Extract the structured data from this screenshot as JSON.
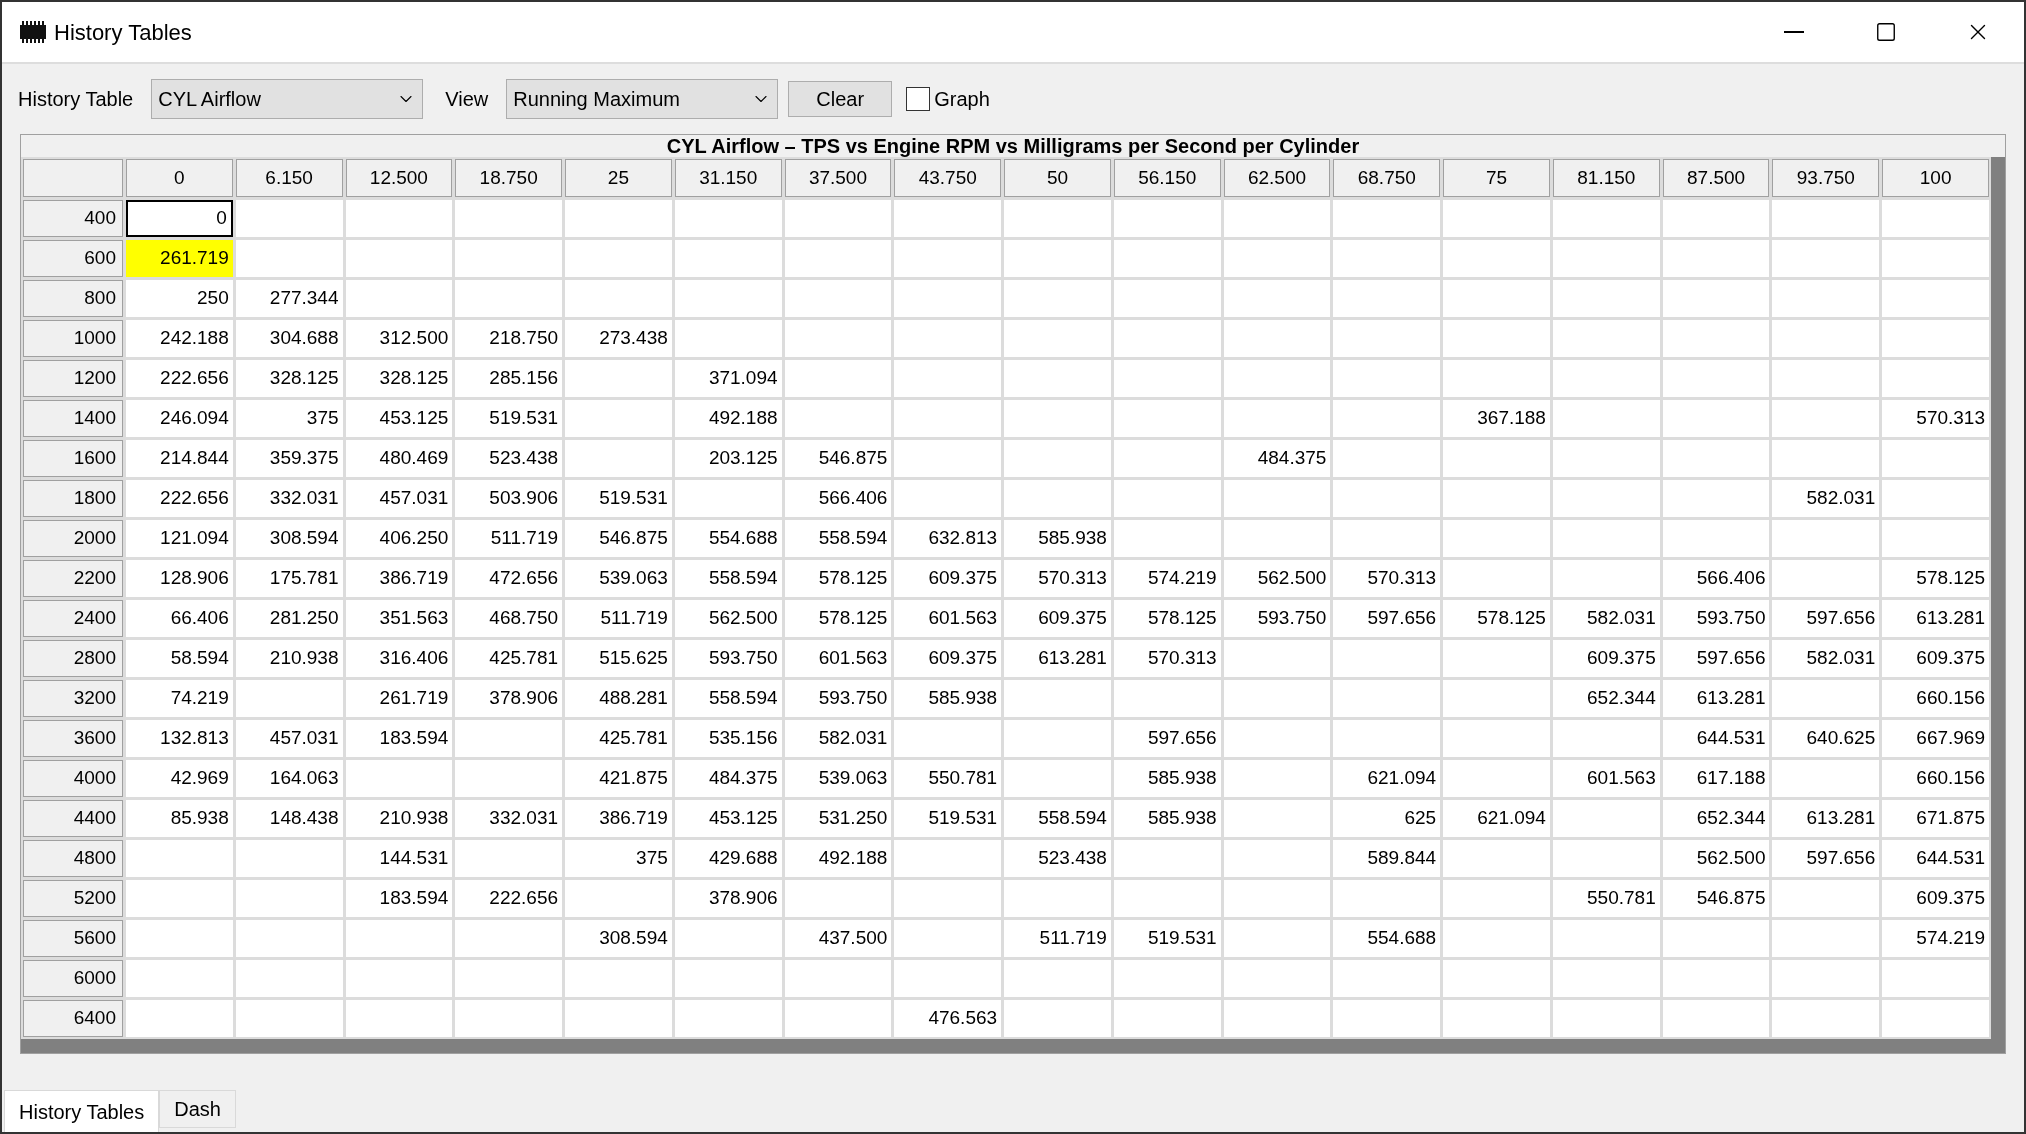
{
  "window": {
    "title": "History Tables"
  },
  "toolbar": {
    "history_table_label": "History Table",
    "history_table_value": "CYL Airflow",
    "view_label": "View",
    "view_value": "Running Maximum",
    "clear_button": "Clear",
    "graph_checkbox": {
      "label": "Graph",
      "checked": false
    }
  },
  "table": {
    "title": "CYL Airflow – TPS vs Engine RPM vs Milligrams per Second per Cylinder",
    "columns": [
      "0",
      "6.150",
      "12.500",
      "18.750",
      "25",
      "31.150",
      "37.500",
      "43.750",
      "50",
      "56.150",
      "62.500",
      "68.750",
      "75",
      "81.150",
      "87.500",
      "93.750",
      "100"
    ],
    "rows": [
      {
        "rpm": "400",
        "cells": [
          {
            "value": "0",
            "selected": true,
            "highlighted": false
          },
          null,
          null,
          null,
          null,
          null,
          null,
          null,
          null,
          null,
          null,
          null,
          null,
          null,
          null,
          null,
          null
        ]
      },
      {
        "rpm": "600",
        "cells": [
          {
            "value": "261.719",
            "selected": false,
            "highlighted": true
          },
          null,
          null,
          null,
          null,
          null,
          null,
          null,
          null,
          null,
          null,
          null,
          null,
          null,
          null,
          null,
          null
        ]
      },
      {
        "rpm": "800",
        "cells": [
          "250",
          "277.344",
          null,
          null,
          null,
          null,
          null,
          null,
          null,
          null,
          null,
          null,
          null,
          null,
          null,
          null,
          null
        ]
      },
      {
        "rpm": "1000",
        "cells": [
          "242.188",
          "304.688",
          "312.500",
          "218.750",
          "273.438",
          null,
          null,
          null,
          null,
          null,
          null,
          null,
          null,
          null,
          null,
          null,
          null
        ]
      },
      {
        "rpm": "1200",
        "cells": [
          "222.656",
          "328.125",
          "328.125",
          "285.156",
          null,
          "371.094",
          null,
          null,
          null,
          null,
          null,
          null,
          null,
          null,
          null,
          null,
          null
        ]
      },
      {
        "rpm": "1400",
        "cells": [
          "246.094",
          "375",
          "453.125",
          "519.531",
          null,
          "492.188",
          null,
          null,
          null,
          null,
          null,
          null,
          "367.188",
          null,
          null,
          null,
          "570.313"
        ]
      },
      {
        "rpm": "1600",
        "cells": [
          "214.844",
          "359.375",
          "480.469",
          "523.438",
          null,
          "203.125",
          "546.875",
          null,
          null,
          null,
          "484.375",
          null,
          null,
          null,
          null,
          null,
          null
        ]
      },
      {
        "rpm": "1800",
        "cells": [
          "222.656",
          "332.031",
          "457.031",
          "503.906",
          "519.531",
          null,
          "566.406",
          null,
          null,
          null,
          null,
          null,
          null,
          null,
          null,
          "582.031",
          null
        ]
      },
      {
        "rpm": "2000",
        "cells": [
          "121.094",
          "308.594",
          "406.250",
          "511.719",
          "546.875",
          "554.688",
          "558.594",
          "632.813",
          "585.938",
          null,
          null,
          null,
          null,
          null,
          null,
          null,
          null
        ]
      },
      {
        "rpm": "2200",
        "cells": [
          "128.906",
          "175.781",
          "386.719",
          "472.656",
          "539.063",
          "558.594",
          "578.125",
          "609.375",
          "570.313",
          "574.219",
          "562.500",
          "570.313",
          null,
          null,
          "566.406",
          null,
          "578.125"
        ]
      },
      {
        "rpm": "2400",
        "cells": [
          "66.406",
          "281.250",
          "351.563",
          "468.750",
          "511.719",
          "562.500",
          "578.125",
          "601.563",
          "609.375",
          "578.125",
          "593.750",
          "597.656",
          "578.125",
          "582.031",
          "593.750",
          "597.656",
          "613.281"
        ]
      },
      {
        "rpm": "2800",
        "cells": [
          "58.594",
          "210.938",
          "316.406",
          "425.781",
          "515.625",
          "593.750",
          "601.563",
          "609.375",
          "613.281",
          "570.313",
          null,
          null,
          null,
          "609.375",
          "597.656",
          "582.031",
          "609.375"
        ]
      },
      {
        "rpm": "3200",
        "cells": [
          "74.219",
          null,
          "261.719",
          "378.906",
          "488.281",
          "558.594",
          "593.750",
          "585.938",
          null,
          null,
          null,
          null,
          null,
          "652.344",
          "613.281",
          null,
          "660.156"
        ]
      },
      {
        "rpm": "3600",
        "cells": [
          "132.813",
          "457.031",
          "183.594",
          null,
          "425.781",
          "535.156",
          "582.031",
          null,
          null,
          "597.656",
          null,
          null,
          null,
          null,
          "644.531",
          "640.625",
          "667.969"
        ]
      },
      {
        "rpm": "4000",
        "cells": [
          "42.969",
          "164.063",
          null,
          null,
          "421.875",
          "484.375",
          "539.063",
          "550.781",
          null,
          "585.938",
          null,
          "621.094",
          null,
          "601.563",
          "617.188",
          null,
          "660.156"
        ]
      },
      {
        "rpm": "4400",
        "cells": [
          "85.938",
          "148.438",
          "210.938",
          "332.031",
          "386.719",
          "453.125",
          "531.250",
          "519.531",
          "558.594",
          "585.938",
          null,
          "625",
          "621.094",
          null,
          "652.344",
          "613.281",
          "671.875"
        ]
      },
      {
        "rpm": "4800",
        "cells": [
          null,
          null,
          "144.531",
          null,
          "375",
          "429.688",
          "492.188",
          null,
          "523.438",
          null,
          null,
          "589.844",
          null,
          null,
          "562.500",
          "597.656",
          "644.531"
        ]
      },
      {
        "rpm": "5200",
        "cells": [
          null,
          null,
          "183.594",
          "222.656",
          null,
          "378.906",
          null,
          null,
          null,
          null,
          null,
          null,
          null,
          "550.781",
          "546.875",
          null,
          "609.375"
        ]
      },
      {
        "rpm": "5600",
        "cells": [
          null,
          null,
          null,
          null,
          "308.594",
          null,
          "437.500",
          null,
          "511.719",
          "519.531",
          null,
          "554.688",
          null,
          null,
          null,
          null,
          "574.219"
        ]
      },
      {
        "rpm": "6000",
        "cells": [
          null,
          null,
          null,
          null,
          null,
          null,
          null,
          null,
          null,
          null,
          null,
          null,
          null,
          null,
          null,
          null,
          null
        ]
      },
      {
        "rpm": "6400",
        "cells": [
          null,
          null,
          null,
          null,
          null,
          null,
          null,
          "476.563",
          null,
          null,
          null,
          null,
          null,
          null,
          null,
          null,
          null
        ]
      }
    ]
  },
  "bottom_tabs": [
    {
      "label": "History Tables",
      "selected": true
    },
    {
      "label": "Dash",
      "selected": false
    }
  ]
}
